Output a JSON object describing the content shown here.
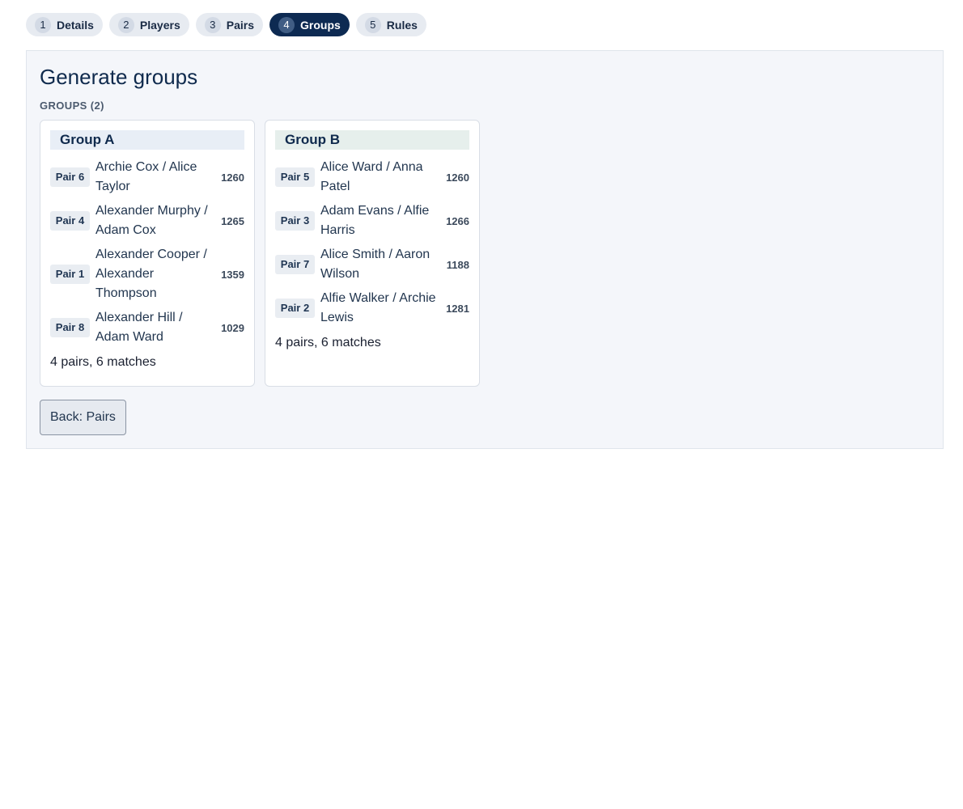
{
  "steps": [
    {
      "num": "1",
      "label": "Details"
    },
    {
      "num": "2",
      "label": "Players"
    },
    {
      "num": "3",
      "label": "Pairs"
    },
    {
      "num": "4",
      "label": "Groups"
    },
    {
      "num": "5",
      "label": "Rules"
    }
  ],
  "active_step": 4,
  "page": {
    "title": "Generate groups",
    "groups_label": "GROUPS (2)",
    "back_label": "Back: Pairs"
  },
  "groups": [
    {
      "name": "Group A",
      "summary": "4 pairs, 6 matches",
      "pairs": [
        {
          "badge": "Pair 6",
          "names": "Archie Cox / Alice Taylor",
          "rating": "1260"
        },
        {
          "badge": "Pair 4",
          "names": "Alexander Murphy / Adam Cox",
          "rating": "1265"
        },
        {
          "badge": "Pair 1",
          "names": "Alexander Cooper / Alexander Thompson",
          "rating": "1359"
        },
        {
          "badge": "Pair 8",
          "names": "Alexander Hill / Adam Ward",
          "rating": "1029"
        }
      ]
    },
    {
      "name": "Group B",
      "summary": "4 pairs, 6 matches",
      "pairs": [
        {
          "badge": "Pair 5",
          "names": "Alice Ward / Anna Patel",
          "rating": "1260"
        },
        {
          "badge": "Pair 3",
          "names": "Adam Evans / Alfie Harris",
          "rating": "1266"
        },
        {
          "badge": "Pair 7",
          "names": "Alice Smith / Aaron Wilson",
          "rating": "1188"
        },
        {
          "badge": "Pair 2",
          "names": "Alfie Walker / Archie Lewis",
          "rating": "1281"
        }
      ]
    }
  ],
  "colors": {
    "active_step_bg": "#0d2a52",
    "group_a_header": "#e8eef6",
    "group_b_header": "#e6efec"
  }
}
